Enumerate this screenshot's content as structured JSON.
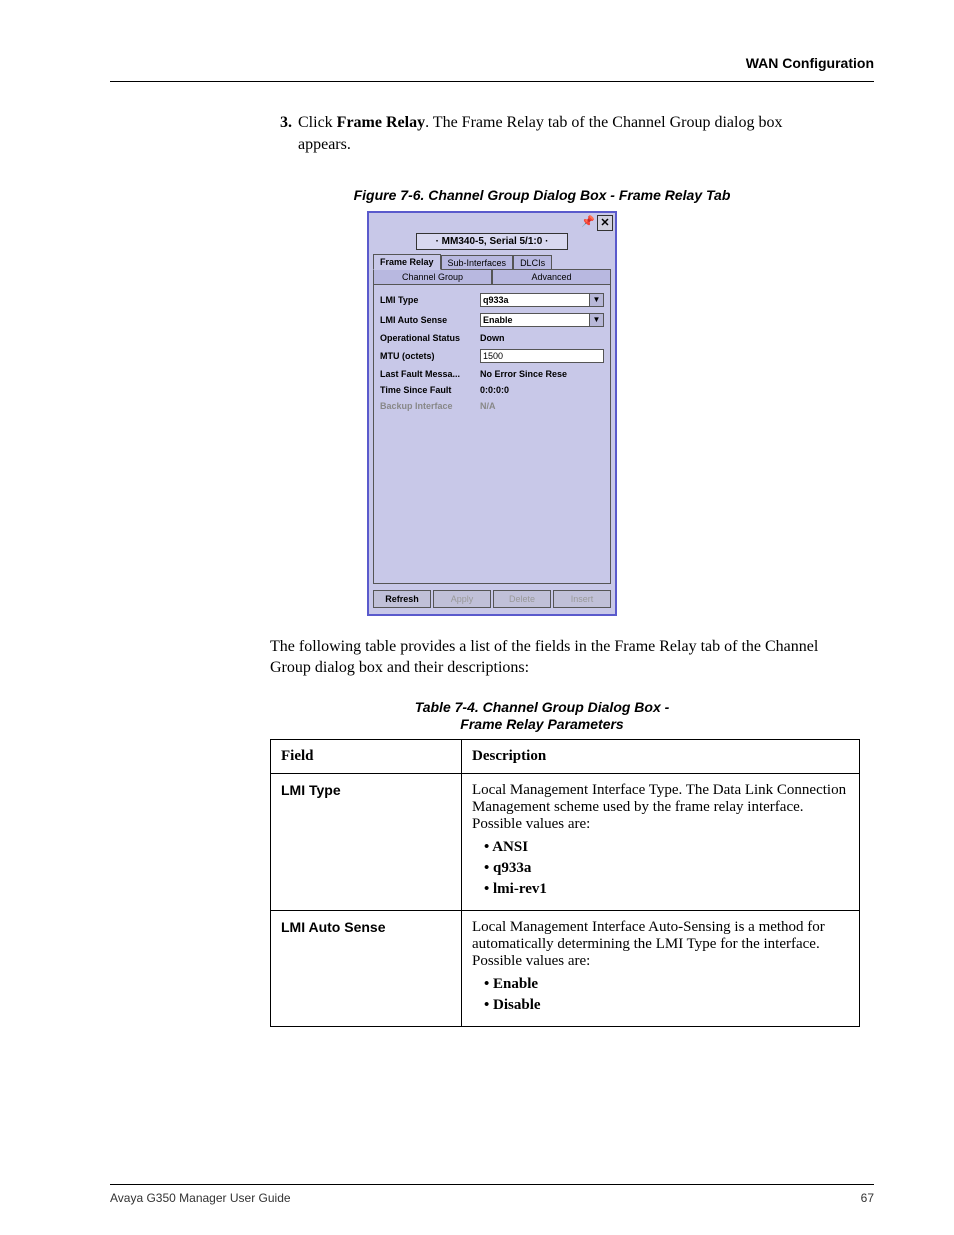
{
  "header": {
    "title": "WAN Configuration"
  },
  "step": {
    "number": "3.",
    "prefix": "Click ",
    "bold": "Frame Relay",
    "suffix": ". The Frame Relay tab of the Channel Group dialog box appears."
  },
  "figure": {
    "caption": "Figure 7-6.  Channel Group Dialog Box - Frame Relay Tab"
  },
  "dialog": {
    "breadcrumb": "· MM340-5, Serial 5/1:0 ·",
    "tabs_top": [
      "Frame Relay",
      "Sub-Interfaces",
      "DLCIs"
    ],
    "tabs_bottom": [
      "Channel Group",
      "Advanced"
    ],
    "fields": {
      "lmi_type": {
        "label": "LMI Type",
        "value": "q933a"
      },
      "lmi_auto": {
        "label": "LMI Auto Sense",
        "value": "Enable"
      },
      "op_status": {
        "label": "Operational Status",
        "value": "Down"
      },
      "mtu": {
        "label": "MTU (octets)",
        "value": "1500"
      },
      "last_fault": {
        "label": "Last Fault Messa...",
        "value": "No Error Since Rese"
      },
      "time_since": {
        "label": "Time Since Fault",
        "value": "0:0:0:0"
      },
      "backup": {
        "label": "Backup Interface",
        "value": "N/A"
      }
    },
    "buttons": [
      "Refresh",
      "Apply",
      "Delete",
      "Insert"
    ]
  },
  "intro": "The following table provides a list of the fields in the Frame Relay tab of the Channel Group dialog box and their descriptions:",
  "table": {
    "caption_line1": "Table 7-4.  Channel Group Dialog Box -",
    "caption_line2": "Frame Relay Parameters",
    "head_field": "Field",
    "head_desc": "Description",
    "rows": [
      {
        "field": "LMI Type",
        "desc": "Local Management Interface Type. The Data Link Connection Management scheme used by the frame relay interface. Possible values are:",
        "bullets": [
          "ANSI",
          "q933a",
          "lmi-rev1"
        ]
      },
      {
        "field": "LMI Auto Sense",
        "desc": "Local Management Interface Auto-Sensing is a method for automatically determining the LMI Type for the interface. Possible values are:",
        "bullets": [
          "Enable",
          "Disable"
        ]
      }
    ]
  },
  "footer": {
    "left": "Avaya G350 Manager User Guide",
    "right": "67"
  }
}
